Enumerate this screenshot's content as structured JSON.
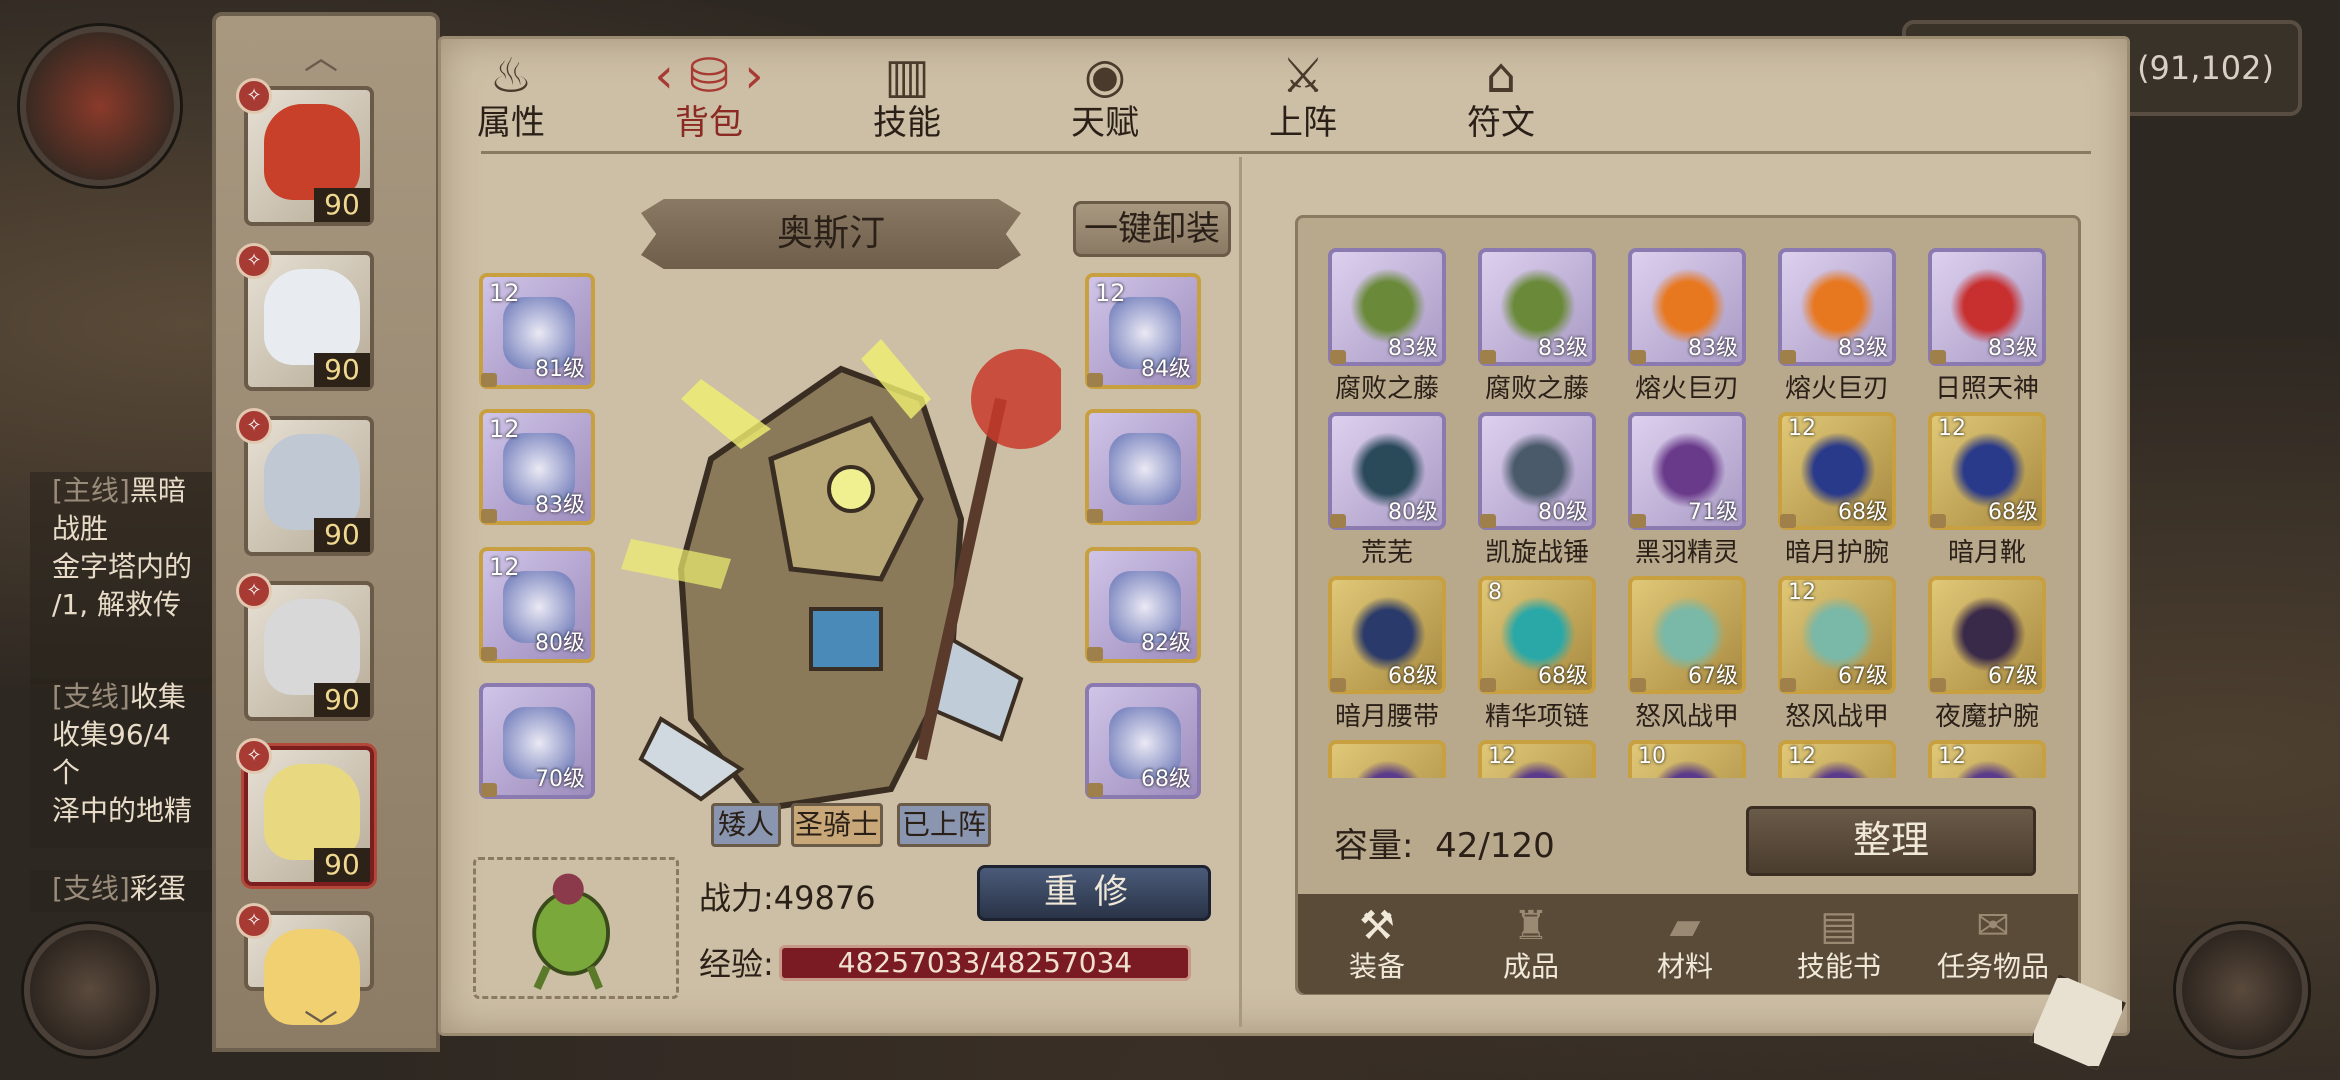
{
  "coord": "(91,102)",
  "quests": [
    {
      "tag": "[主线]",
      "title": "黑暗",
      "lines": [
        "战胜",
        "金字塔内的",
        "/1, 解救传"
      ]
    },
    {
      "tag": "[支线]",
      "title": "收集",
      "lines": [
        "收集96/4",
        "个",
        "泽中的地精"
      ]
    },
    {
      "tag": "[支线]",
      "title": "彩蛋"
    }
  ],
  "tabs": [
    {
      "label": "属性",
      "icon": "flame-icon"
    },
    {
      "label": "背包",
      "icon": "bag-icon",
      "active": true
    },
    {
      "label": "技能",
      "icon": "book-icon"
    },
    {
      "label": "天赋",
      "icon": "eye-icon"
    },
    {
      "label": "上阵",
      "icon": "crossed-swords-icon"
    },
    {
      "label": "符文",
      "icon": "rune-icon"
    }
  ],
  "heroes": [
    {
      "level": "90",
      "color": "#c8402a"
    },
    {
      "level": "90",
      "color": "#e8ecf0"
    },
    {
      "level": "90",
      "color": "#c0c8d4"
    },
    {
      "level": "90",
      "color": "#d8d8d8"
    },
    {
      "level": "90",
      "color": "#e8d880",
      "selected": true
    },
    {
      "level": "",
      "color": "#f0d070"
    }
  ],
  "character": {
    "name": "奥斯汀",
    "unequip_all": "一键卸装",
    "tags": [
      "矮人",
      "圣骑士",
      "已上阵"
    ],
    "power_label": "战力:",
    "power_value": "49876",
    "rebuild": "重修",
    "exp_label": "经验:",
    "exp_value": "48257033/48257034"
  },
  "equipment_left": [
    {
      "num": "12",
      "level": "81级"
    },
    {
      "num": "12",
      "level": "83级"
    },
    {
      "num": "12",
      "level": "80级"
    },
    {
      "num": "",
      "level": "70级"
    }
  ],
  "equipment_right": [
    {
      "num": "12",
      "level": "84级"
    },
    {
      "num": "",
      "level": ""
    },
    {
      "num": "",
      "level": "82级"
    },
    {
      "num": "",
      "level": "68级"
    }
  ],
  "inventory": {
    "items": [
      {
        "name": "腐败之藤",
        "level": "83级",
        "num": "",
        "color": "#6a8a3a"
      },
      {
        "name": "腐败之藤",
        "level": "83级",
        "num": "",
        "color": "#6a8a3a"
      },
      {
        "name": "熔火巨刃",
        "level": "83级",
        "num": "",
        "color": "#e87820"
      },
      {
        "name": "熔火巨刃",
        "level": "83级",
        "num": "",
        "color": "#e87820"
      },
      {
        "name": "日照天神",
        "level": "83级",
        "num": "",
        "color": "#c83030"
      },
      {
        "name": "荒芜",
        "level": "80级",
        "num": "",
        "color": "#2a4a5a"
      },
      {
        "name": "凯旋战锤",
        "level": "80级",
        "num": "",
        "color": "#4a5a6a"
      },
      {
        "name": "黑羽精灵",
        "level": "71级",
        "num": "",
        "color": "#6a3a8a"
      },
      {
        "name": "暗月护腕",
        "level": "68级",
        "num": "12",
        "color": "#2a3a8a",
        "gold": true
      },
      {
        "name": "暗月靴",
        "level": "68级",
        "num": "12",
        "color": "#2a3a8a",
        "gold": true
      },
      {
        "name": "暗月腰带",
        "level": "68级",
        "num": "",
        "color": "#2a3a6a",
        "gold": true
      },
      {
        "name": "精华项链",
        "level": "68级",
        "num": "8",
        "color": "#2aa8a8",
        "gold": true
      },
      {
        "name": "怒风战甲",
        "level": "67级",
        "num": "",
        "color": "#7ab8a8",
        "gold": true
      },
      {
        "name": "怒风战甲",
        "level": "67级",
        "num": "12",
        "color": "#7ab8a8",
        "gold": true
      },
      {
        "name": "夜魔护腕",
        "level": "67级",
        "num": "",
        "color": "#3a2a4a",
        "gold": true
      },
      {
        "name": "",
        "level": "",
        "num": "",
        "color": "#5a3a8a",
        "gold": true
      },
      {
        "name": "",
        "level": "",
        "num": "12",
        "color": "#5a3a8a",
        "gold": true
      },
      {
        "name": "",
        "level": "",
        "num": "10",
        "color": "#5a3a8a",
        "gold": true
      },
      {
        "name": "",
        "level": "",
        "num": "12",
        "color": "#5a3a8a",
        "gold": true
      },
      {
        "name": "",
        "level": "",
        "num": "12",
        "color": "#5a3a8a",
        "gold": true
      }
    ],
    "capacity_label": "容量:",
    "capacity_value": "42/120",
    "sort": "整理",
    "categories": [
      {
        "label": "装备",
        "icon": "hammer-icon",
        "active": true
      },
      {
        "label": "成品",
        "icon": "potion-icon"
      },
      {
        "label": "材料",
        "icon": "ingot-icon"
      },
      {
        "label": "技能书",
        "icon": "scroll-icon"
      },
      {
        "label": "任务物品",
        "icon": "quest-scroll-icon"
      }
    ]
  }
}
